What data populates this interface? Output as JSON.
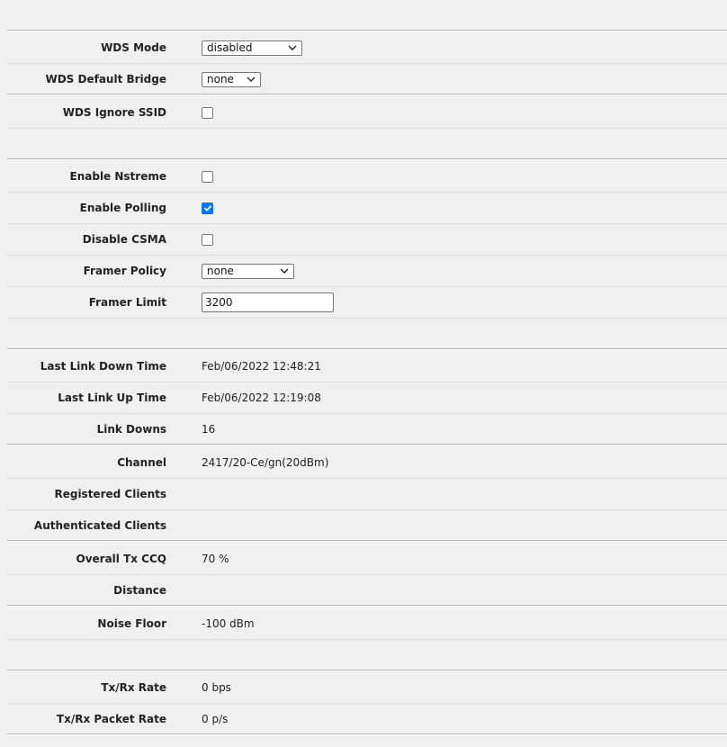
{
  "wds": {
    "mode_label": "WDS Mode",
    "mode_value": "disabled",
    "default_bridge_label": "WDS Default Bridge",
    "default_bridge_value": "none",
    "ignore_ssid_label": "WDS Ignore SSID",
    "ignore_ssid_checked": false
  },
  "nstreme": {
    "enable_nstreme_label": "Enable Nstreme",
    "enable_nstreme_checked": false,
    "enable_polling_label": "Enable Polling",
    "enable_polling_checked": true,
    "disable_csma_label": "Disable CSMA",
    "disable_csma_checked": false,
    "framer_policy_label": "Framer Policy",
    "framer_policy_value": "none",
    "framer_limit_label": "Framer Limit",
    "framer_limit_value": "3200"
  },
  "status": {
    "last_link_down_label": "Last Link Down Time",
    "last_link_down_value": "Feb/06/2022 12:48:21",
    "last_link_up_label": "Last Link Up Time",
    "last_link_up_value": "Feb/06/2022 12:19:08",
    "link_downs_label": "Link Downs",
    "link_downs_value": "16",
    "channel_label": "Channel",
    "channel_value": "2417/20-Ce/gn(20dBm)",
    "registered_clients_label": "Registered Clients",
    "registered_clients_value": "",
    "authenticated_clients_label": "Authenticated Clients",
    "authenticated_clients_value": "",
    "overall_tx_ccq_label": "Overall Tx CCQ",
    "overall_tx_ccq_value": "70 %",
    "distance_label": "Distance",
    "distance_value": "",
    "noise_floor_label": "Noise Floor",
    "noise_floor_value": "-100 dBm",
    "tx_rx_rate_label": "Tx/Rx Rate",
    "tx_rx_rate_value": "0 bps",
    "tx_rx_packet_rate_label": "Tx/Rx Packet Rate",
    "tx_rx_packet_rate_value": "0 p/s"
  },
  "colors": {
    "checkbox_checked": "#0075ff",
    "page_background": "#f0f0f0"
  }
}
